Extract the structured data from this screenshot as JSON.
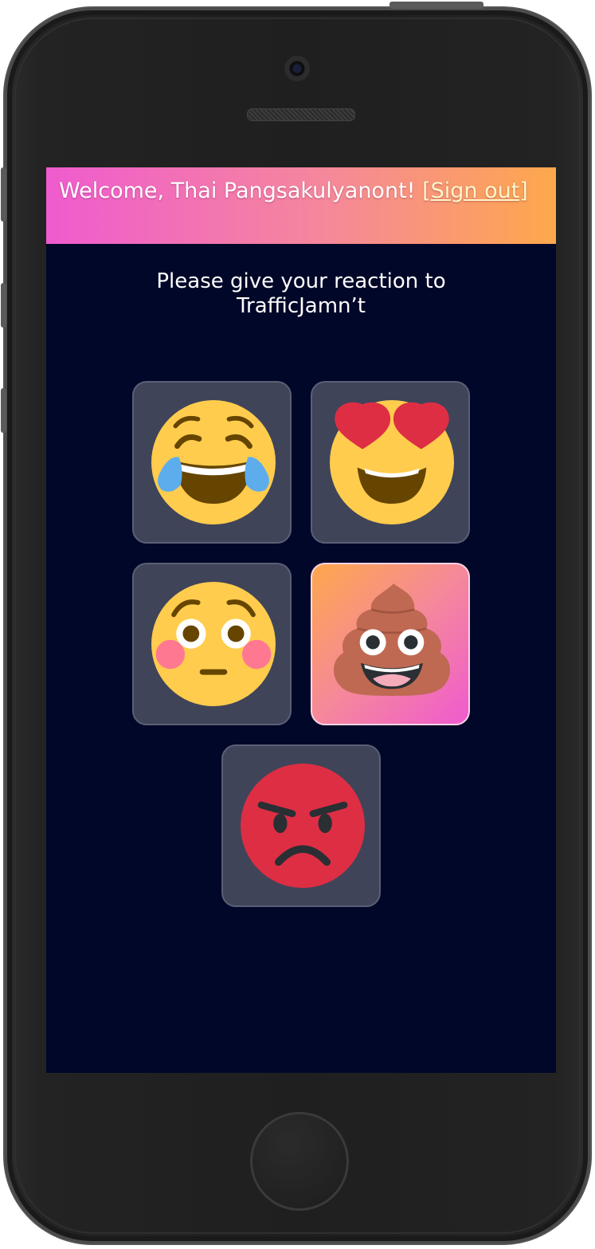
{
  "banner": {
    "welcome_text": "Welcome, Thai Pangsakulyanont! ",
    "signout_label": "[Sign out]"
  },
  "prompt": {
    "line1": "Please give your reaction to",
    "line2": "TrafficJamn’t"
  },
  "reactions": [
    {
      "name": "tears-of-joy",
      "icon": "face-with-tears-of-joy-icon",
      "selected": false
    },
    {
      "name": "heart-eyes",
      "icon": "heart-eyes-face-icon",
      "selected": false
    },
    {
      "name": "flushed",
      "icon": "flushed-face-icon",
      "selected": false
    },
    {
      "name": "pile-of-poo",
      "icon": "pile-of-poo-icon",
      "selected": true
    },
    {
      "name": "angry",
      "icon": "angry-face-icon",
      "selected": false
    }
  ],
  "colors": {
    "screen_bg": "#000728",
    "tile_bg": "#3f4459",
    "banner_gradient_start": "#ef5bcf",
    "banner_gradient_end": "#fda84c",
    "signout_link": "#fff6c9"
  }
}
